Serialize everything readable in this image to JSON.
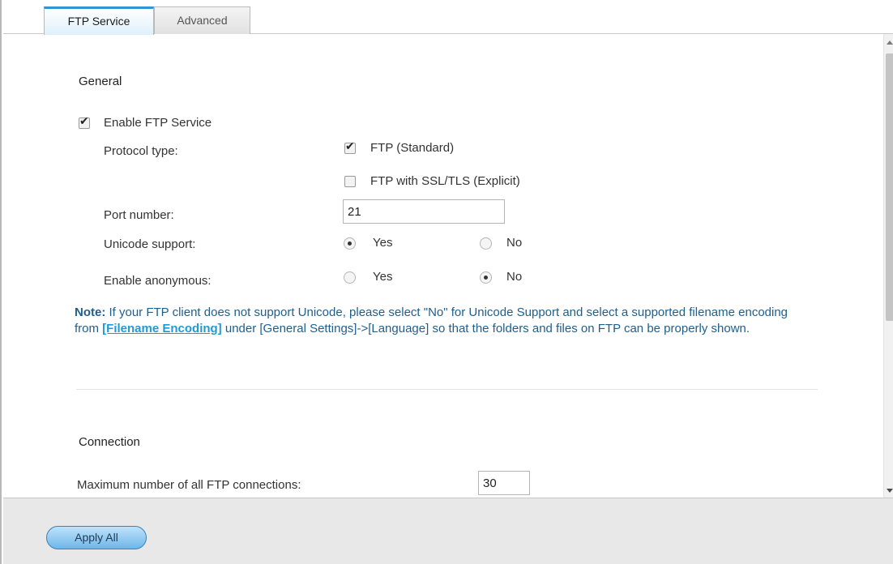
{
  "tabs": [
    {
      "label": "FTP Service",
      "active": true
    },
    {
      "label": "Advanced",
      "active": false
    }
  ],
  "general": {
    "title": "General",
    "enable_ftp": {
      "label": "Enable FTP Service",
      "checked": true
    },
    "protocol_type": {
      "label": "Protocol type:",
      "options": [
        {
          "label": "FTP (Standard)",
          "checked": true
        },
        {
          "label": "FTP with SSL/TLS (Explicit)",
          "checked": false
        }
      ]
    },
    "port_number": {
      "label": "Port number:",
      "value": "21"
    },
    "unicode_support": {
      "label": "Unicode support:",
      "yes": "Yes",
      "no": "No",
      "selected": "Yes"
    },
    "enable_anonymous": {
      "label": "Enable anonymous:",
      "yes": "Yes",
      "no": "No",
      "selected": "No"
    },
    "note": {
      "prefix": "Note:",
      "text1": " If your FTP client does not support Unicode, please select \"No\" for Unicode Support and select a supported filename encoding from ",
      "link": "[Filename Encoding]",
      "text2": " under [General Settings]->[Language] so that the folders and files on FTP can be properly shown."
    }
  },
  "connection": {
    "title": "Connection",
    "max_connections": {
      "label": "Maximum number of all FTP connections:",
      "value": "30"
    }
  },
  "footer": {
    "apply_label": "Apply All"
  },
  "colors": {
    "accent": "#2f96d6",
    "note_text": "#1f5f8d",
    "link": "#1e9bd6"
  }
}
